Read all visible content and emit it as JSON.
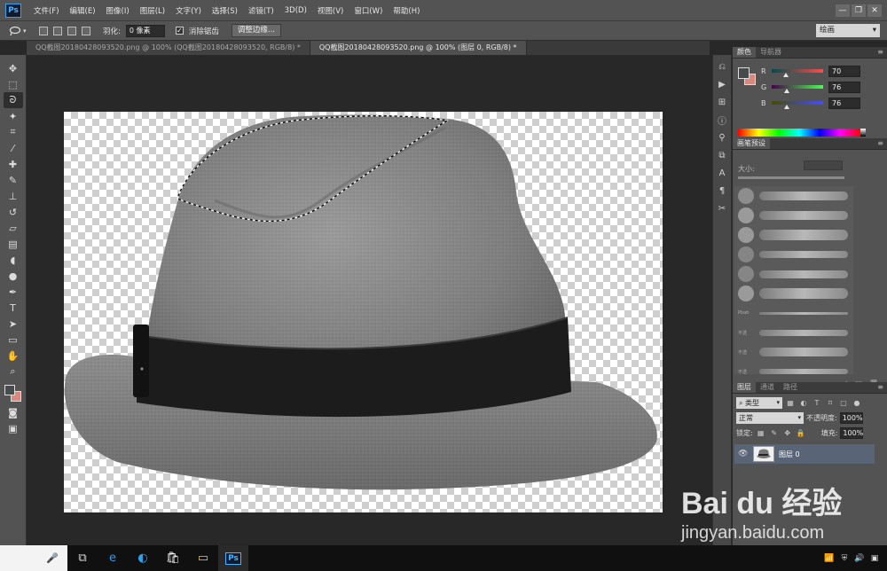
{
  "app": {
    "logo": "Ps"
  },
  "menu": [
    "文件(F)",
    "编辑(E)",
    "图像(I)",
    "图层(L)",
    "文字(Y)",
    "选择(S)",
    "滤镜(T)",
    "3D(D)",
    "视图(V)",
    "窗口(W)",
    "帮助(H)"
  ],
  "window_controls": {
    "minimize": "—",
    "restore": "❐",
    "close": "✕"
  },
  "options": {
    "feather_label": "羽化:",
    "feather_value": "0 像素",
    "antialias_label": "消除锯齿",
    "antialias_checked": "✓",
    "refine_edge": "调整边缘...",
    "workspace": "绘画"
  },
  "tabs": [
    {
      "label": "QQ截图20180428093520.png @ 100% (QQ截图20180428093520, RGB/8) *",
      "active": false
    },
    {
      "label": "QQ截图20180428093520.png @ 100% (图层 0, RGB/8) *",
      "active": true
    }
  ],
  "tools": [
    "move-icon",
    "marquee-icon",
    "lasso-icon",
    "magic-wand-icon",
    "crop-icon",
    "eyedropper-icon",
    "healing-icon",
    "brush-icon",
    "stamp-icon",
    "history-brush-icon",
    "eraser-icon",
    "gradient-icon",
    "blur-icon",
    "dodge-icon",
    "pen-icon",
    "type-icon",
    "path-select-icon",
    "shape-icon",
    "hand-icon",
    "zoom-icon"
  ],
  "colors": {
    "foreground": "#464c4c",
    "background": "#d98a80",
    "accent_layer": "#596577"
  },
  "color_panel": {
    "tabs": [
      "颜色",
      "导航器"
    ],
    "channels": [
      {
        "label": "R",
        "value": "70",
        "fraction": 0.27
      },
      {
        "label": "G",
        "value": "76",
        "fraction": 0.3
      },
      {
        "label": "B",
        "value": "76",
        "fraction": 0.3
      }
    ]
  },
  "brush_panel": {
    "tabs": [
      "画笔预设"
    ],
    "size_label": "大小:",
    "presets": [
      "硬",
      "硬",
      "硬",
      "柔",
      "柔",
      "柔"
    ],
    "stroke_labels": [
      "Pbab",
      "不透",
      "不透",
      "不透"
    ]
  },
  "layers_panel": {
    "tabs": [
      "图层",
      "通道",
      "路径"
    ],
    "filter_kind": "类型",
    "blend_mode": "正常",
    "opacity_label": "不透明度:",
    "opacity_value": "100%",
    "lock_label": "锁定:",
    "fill_label": "填充:",
    "fill_value": "100%",
    "layer_name": "图层 0"
  },
  "taskbar": {
    "mic": "🎤",
    "ps_label": "Ps"
  },
  "watermark": {
    "brand": "Bai du 经验",
    "url": "jingyan.baidu.com"
  }
}
